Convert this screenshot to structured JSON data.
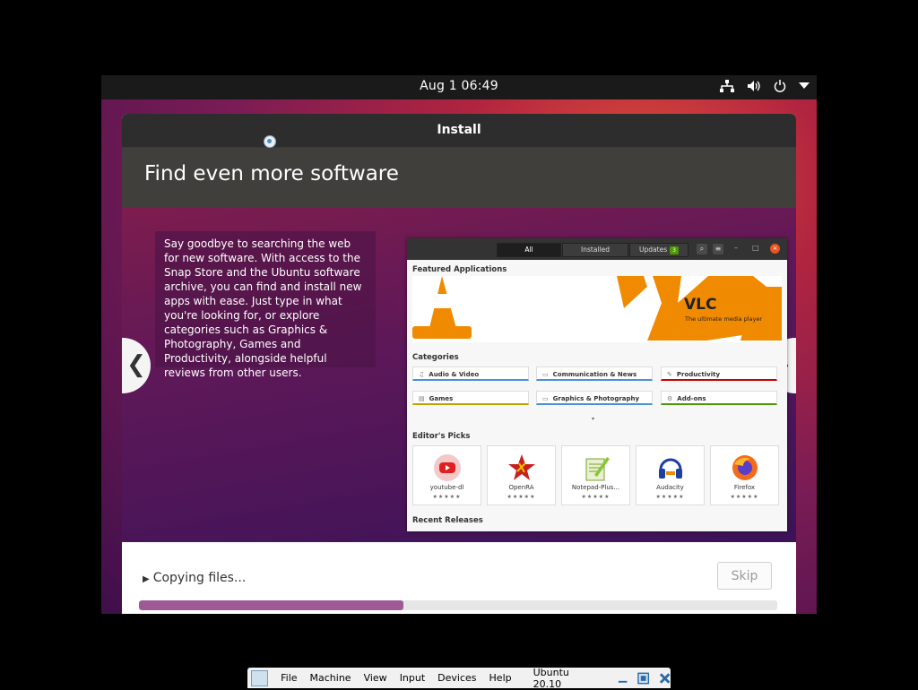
{
  "topbar": {
    "clock": "Aug 1  06:49",
    "icons": [
      "network-icon",
      "volume-icon",
      "power-icon",
      "menu-arrow-icon"
    ]
  },
  "window": {
    "title": "Install",
    "header": "Find even more software"
  },
  "slide": {
    "text": "Say goodbye to searching the web for new software. With access to the Snap Store and the Ubuntu software archive, you can find and install new apps with ease. Just type in what you're looking for, or explore categories such as Graphics & Photography, Games and Productivity, alongside helpful reviews from other users.",
    "prev_arrow": "❮",
    "next_arrow": "❯",
    "screenshot": {
      "tabs": {
        "all": "All",
        "installed": "Installed",
        "updates": "Updates",
        "updates_count": "3"
      },
      "featured_title": "Featured Applications",
      "banner": {
        "title": "VLC",
        "subtitle": "The ultimate media player"
      },
      "categories_title": "Categories",
      "categories": [
        {
          "label": "Audio & Video",
          "icon": "♫",
          "color": "#4a90d9"
        },
        {
          "label": "Communication & News",
          "icon": "▭",
          "color": "#4a90d9"
        },
        {
          "label": "Productivity",
          "icon": "✎",
          "color": "#cc0000"
        },
        {
          "label": "Games",
          "icon": "▤",
          "color": "#c4a000"
        },
        {
          "label": "Graphics & Photography",
          "icon": "▭",
          "color": "#4a90d9"
        },
        {
          "label": "Add-ons",
          "icon": "⚙",
          "color": "#4e9a06"
        }
      ],
      "more": "▾",
      "picks_title": "Editor's Picks",
      "picks": [
        {
          "name": "youtube-dl",
          "stars": "★★★★★"
        },
        {
          "name": "OpenRA",
          "stars": "★★★★★"
        },
        {
          "name": "Notepad-Plus...",
          "stars": "★★★★★"
        },
        {
          "name": "Audacity",
          "stars": "★★★★★"
        },
        {
          "name": "Firefox",
          "stars": "★★★★★"
        }
      ],
      "recent_title": "Recent Releases"
    }
  },
  "install": {
    "status": "Copying files...",
    "skip_label": "Skip",
    "progress": 0.415
  },
  "vbox_menu": {
    "items": [
      "File",
      "Machine",
      "View",
      "Input",
      "Devices",
      "Help"
    ],
    "vm_name": "Ubuntu 20.10"
  }
}
